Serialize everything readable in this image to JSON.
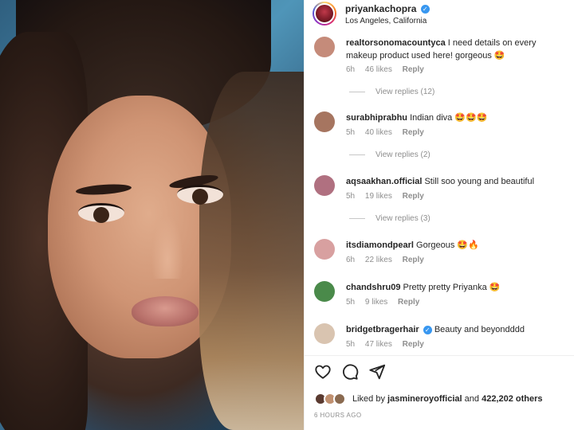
{
  "post": {
    "username": "priyankachopra",
    "location": "Los Angeles, California"
  },
  "comments": [
    {
      "username": "realtorsonomacountyca",
      "text": "I need details on every makeup product used here! gorgeous 🤩",
      "time": "6h",
      "likes": "46 likes",
      "reply": "Reply",
      "view_replies": "View replies (12)",
      "avatar_color": "#c58b7a"
    },
    {
      "username": "surabhiprabhu",
      "text": "Indian diva 🤩🤩🤩",
      "time": "5h",
      "likes": "40 likes",
      "reply": "Reply",
      "view_replies": "View replies (2)",
      "avatar_color": "#a67560"
    },
    {
      "username": "aqsaakhan.official",
      "text": "Still soo young and beautiful",
      "time": "5h",
      "likes": "19 likes",
      "reply": "Reply",
      "view_replies": "View replies (3)",
      "avatar_color": "#b07080"
    },
    {
      "username": "itsdiamondpearl",
      "text": "Gorgeous 🤩🔥",
      "time": "6h",
      "likes": "22 likes",
      "reply": "Reply",
      "avatar_color": "#d8a0a0"
    },
    {
      "username": "chandshru09",
      "text": "Pretty pretty Priyanka 🤩",
      "time": "5h",
      "likes": "9 likes",
      "reply": "Reply",
      "avatar_color": "#4a8a4a"
    },
    {
      "username": "bridgetbragerhair",
      "text": "Beauty and beyondddd",
      "time": "5h",
      "likes": "47 likes",
      "reply": "Reply",
      "avatar_color": "#d9c4b0"
    }
  ],
  "footer": {
    "liked_by_prefix": "Liked by",
    "liked_by_user": "jasmineroyofficial",
    "liked_by_and": "and",
    "liked_by_count": "422,202 others",
    "time_ago": "6 HOURS AGO",
    "liked_avatar_colors": [
      "#5a3a30",
      "#c09070",
      "#8a6a50"
    ]
  },
  "colors": {
    "verified": "#3897f0",
    "muted_text": "#8e8e8e",
    "text": "#262626"
  }
}
